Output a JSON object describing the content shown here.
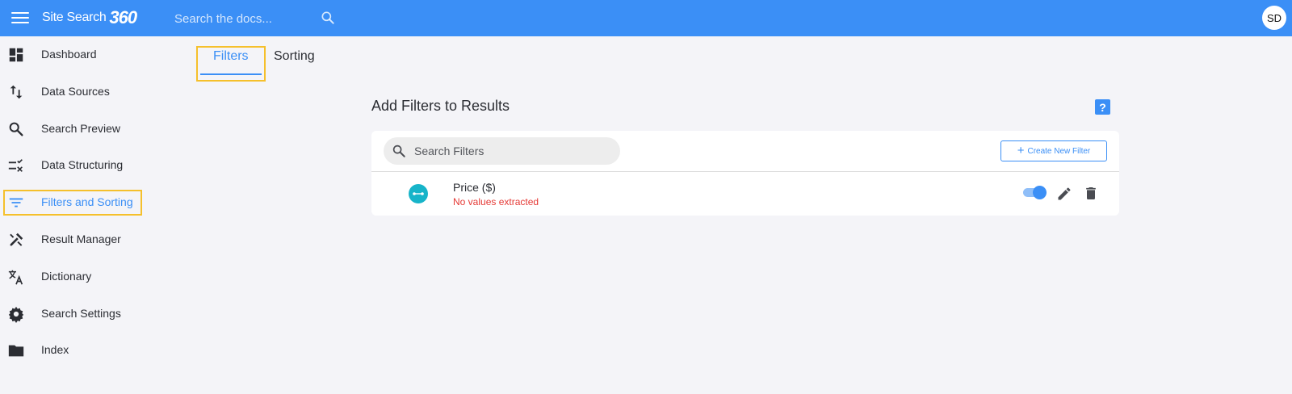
{
  "app": {
    "logo_text": "Site Search",
    "logo_mark": "360",
    "search_placeholder": "Search the docs...",
    "avatar_initials": "SD",
    "accent_color": "#3b8ff6",
    "highlight_color": "#f5c02c"
  },
  "sidebar": {
    "items": [
      {
        "label": "Dashboard",
        "icon": "dashboard-icon"
      },
      {
        "label": "Data Sources",
        "icon": "data-sources-icon"
      },
      {
        "label": "Search Preview",
        "icon": "search-icon"
      },
      {
        "label": "Data Structuring",
        "icon": "data-structuring-icon"
      },
      {
        "label": "Filters and Sorting",
        "icon": "filter-icon",
        "active": true
      },
      {
        "label": "Result Manager",
        "icon": "tools-icon"
      },
      {
        "label": "Dictionary",
        "icon": "translate-icon"
      },
      {
        "label": "Search Settings",
        "icon": "gear-icon"
      },
      {
        "label": "Index",
        "icon": "folder-icon"
      }
    ]
  },
  "tabs": [
    {
      "label": "Filters",
      "active": true
    },
    {
      "label": "Sorting",
      "active": false
    }
  ],
  "main": {
    "heading": "Add Filters to Results",
    "help_label": "?",
    "search_placeholder": "Search Filters",
    "create_button": "Create New Filter",
    "filters": [
      {
        "title": "Price ($)",
        "status": "No values extracted",
        "status_color": "#e53935",
        "icon": "range-icon",
        "enabled": true
      }
    ]
  }
}
